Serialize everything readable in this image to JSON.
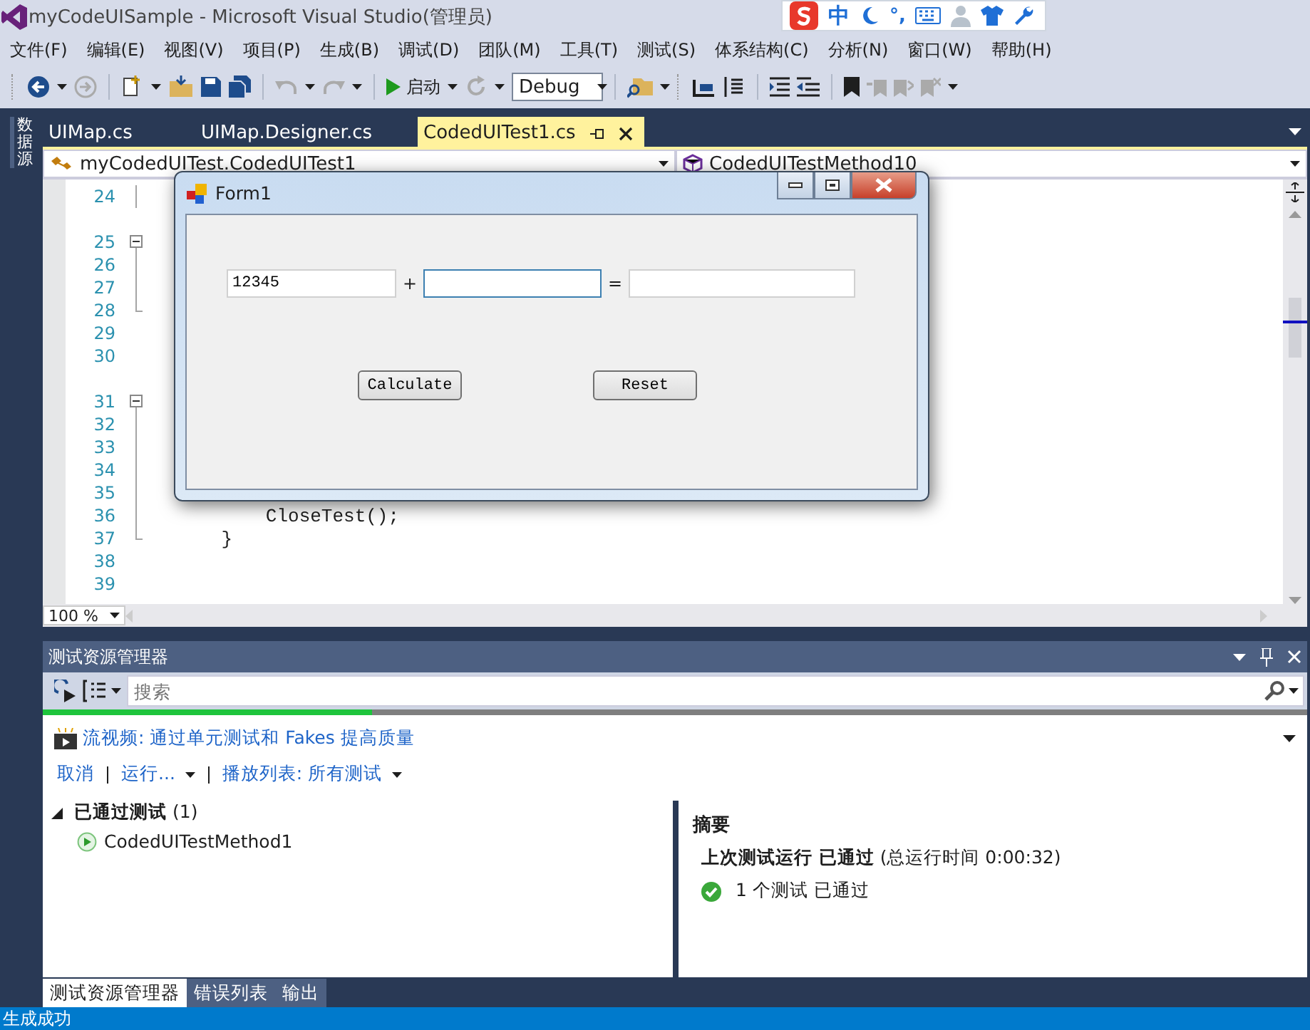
{
  "window": {
    "title": "myCodeUISample - Microsoft Visual Studio(管理员)"
  },
  "ime_bar": {
    "mode": "中",
    "punctuation": "°,"
  },
  "menu": [
    "文件(F)",
    "编辑(E)",
    "视图(V)",
    "项目(P)",
    "生成(B)",
    "调试(D)",
    "团队(M)",
    "工具(T)",
    "测试(S)",
    "体系结构(C)",
    "分析(N)",
    "窗口(W)",
    "帮助(H)"
  ],
  "toolbar": {
    "start_label": "启动",
    "configuration": "Debug"
  },
  "side_tabs": [
    "数据源"
  ],
  "doc_tabs": [
    {
      "label": "UIMap.cs",
      "selected": false
    },
    {
      "label": "UIMap.Designer.cs",
      "selected": false
    },
    {
      "label": "CodedUITest1.cs",
      "selected": true
    }
  ],
  "nav_bar": {
    "type": "myCodedUITest.CodedUITest1",
    "member": "CodedUITestMethod10"
  },
  "editor": {
    "zoom": "100 %",
    "rows": [
      {
        "kind": "fold_line",
        "number": "24"
      },
      {
        "kind": "spacer"
      },
      {
        "kind": "fold_start",
        "number": "25"
      },
      {
        "kind": "fold_line",
        "number": "26"
      },
      {
        "kind": "fold_line",
        "number": "27"
      },
      {
        "kind": "fold_end",
        "number": "28"
      },
      {
        "kind": "line",
        "number": "29"
      },
      {
        "kind": "line",
        "number": "30"
      },
      {
        "kind": "spacer"
      },
      {
        "kind": "fold_start",
        "number": "31"
      },
      {
        "kind": "fold_line",
        "number": "32"
      },
      {
        "kind": "fold_line",
        "number": "33"
      },
      {
        "kind": "fold_line",
        "number": "34"
      },
      {
        "kind": "fold_line",
        "number": "35"
      },
      {
        "kind": "fold_line",
        "number": "36",
        "code": "        CloseTest();"
      },
      {
        "kind": "fold_end",
        "number": "37",
        "code": "    }"
      },
      {
        "kind": "line",
        "number": "38"
      },
      {
        "kind": "line",
        "number": "39"
      }
    ]
  },
  "form": {
    "title": "Form1",
    "fields": [
      {
        "value": "12345",
        "focused": false
      },
      {
        "focused": true
      },
      {
        "focused": false
      }
    ],
    "operators": [
      "+",
      "="
    ],
    "buttons": [
      "Calculate",
      "Reset"
    ]
  },
  "test_explorer": {
    "title": "测试资源管理器",
    "search": {
      "placeholder": "搜索"
    },
    "progress": {
      "level": 0.26
    },
    "promo_link": "流视频: 通过单元测试和 Fakes 提高质量",
    "actions": [
      {
        "label": "取消",
        "dropdown": false
      },
      {
        "label": "运行...",
        "dropdown": true
      },
      {
        "label": "播放列表: 所有测试",
        "dropdown": true
      }
    ],
    "groups": [
      {
        "label": "已通过测试",
        "count": "(1)",
        "expanded": true,
        "children": [
          {
            "name": "CodedUITestMethod1"
          }
        ]
      }
    ],
    "summary": {
      "heading": "摘要",
      "last_run": "**上次测试运行 已通过** (总运行时间 0:00:32)",
      "result": "1 个测试 已通过"
    }
  },
  "bottom_tabs": [
    {
      "label": "测试资源管理器",
      "selected": true
    },
    {
      "label": "错误列表",
      "selected": false
    },
    {
      "label": "输出",
      "selected": false
    }
  ],
  "status_bar": {
    "text": "生成成功"
  }
}
